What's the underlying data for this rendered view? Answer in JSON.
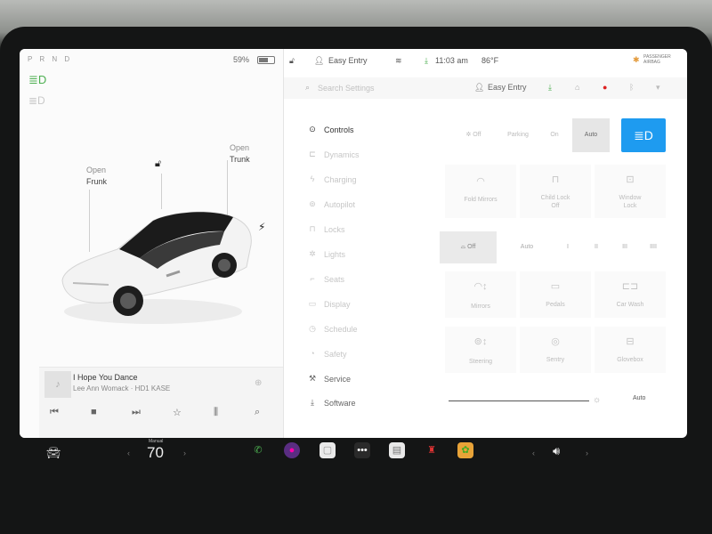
{
  "left": {
    "gear_indicator": "P R N D",
    "battery_percent": "59%",
    "open_frunk": {
      "line1": "Open",
      "line2": "Frunk"
    },
    "open_trunk": {
      "line1": "Open",
      "line2": "Trunk"
    }
  },
  "media": {
    "track_title": "I Hope You Dance",
    "track_artist": "Lee Ann Womack · HD1 KASE"
  },
  "status_bar": {
    "profile": "Easy Entry",
    "time": "11:03 am",
    "temperature": "86°F",
    "airbag_line1": "PASSENGER",
    "airbag_line2": "AIRBAG"
  },
  "search": {
    "placeholder": "Search Settings",
    "profile": "Easy Entry"
  },
  "menu": {
    "items": [
      {
        "label": "Controls",
        "icon": "toggle-icon"
      },
      {
        "label": "Dynamics",
        "icon": "car-icon"
      },
      {
        "label": "Charging",
        "icon": "bolt-icon"
      },
      {
        "label": "Autopilot",
        "icon": "steering-wheel-icon"
      },
      {
        "label": "Locks",
        "icon": "lock-icon"
      },
      {
        "label": "Lights",
        "icon": "sun-icon"
      },
      {
        "label": "Seats",
        "icon": "seat-icon"
      },
      {
        "label": "Display",
        "icon": "display-icon"
      },
      {
        "label": "Schedule",
        "icon": "schedule-icon"
      },
      {
        "label": "Safety",
        "icon": "safety-icon"
      },
      {
        "label": "Service",
        "icon": "wrench-icon"
      },
      {
        "label": "Software",
        "icon": "download-icon"
      }
    ]
  },
  "controls": {
    "lights": {
      "off": "Off",
      "parking": "Parking",
      "on": "On",
      "auto": "Auto"
    },
    "fold_mirrors": "Fold Mirrors",
    "child_lock": {
      "line1": "Child Lock",
      "line2": "Off"
    },
    "window_lock": {
      "line1": "Window",
      "line2": "Lock"
    },
    "wipers": {
      "off": "Off",
      "auto": "Auto",
      "s1": "I",
      "s2": "II",
      "s3": "III",
      "s4": "IIII"
    },
    "mirrors": "Mirrors",
    "steering": "Steering",
    "pedals": "Pedals",
    "sentry": "Sentry",
    "car_wash": "Car Wash",
    "glovebox": "Glovebox",
    "brightness_auto": "Auto"
  },
  "dock": {
    "speed_label": "Manual",
    "speed_value": "70"
  },
  "colors": {
    "accent_blue": "#1e9bf0",
    "headlight_green": "#4caf50",
    "screen_bg": "#ffffff"
  }
}
